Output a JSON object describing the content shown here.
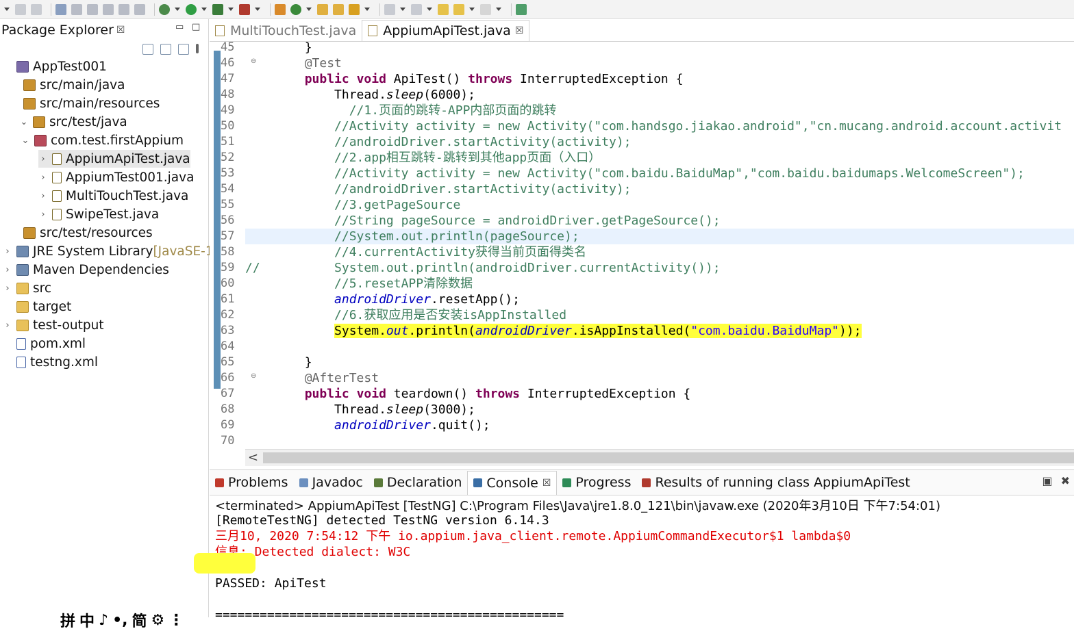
{
  "explorer": {
    "title": "Package Explorer",
    "close": "☒",
    "items": [
      {
        "label": "AppTest001",
        "decor": "",
        "twisty": "",
        "icon": "project-icon",
        "depth": 0
      },
      {
        "label": "src/main/java",
        "decor": "",
        "twisty": "",
        "icon": "source-folder-icon",
        "depth": 1
      },
      {
        "label": "src/main/resources",
        "decor": "",
        "twisty": "",
        "icon": "source-folder-icon",
        "depth": 1
      },
      {
        "label": "src/test/java",
        "decor": "",
        "twisty": "⌄",
        "icon": "source-folder-icon",
        "depth": 1
      },
      {
        "label": "com.test.firstAppium",
        "decor": "",
        "twisty": "⌄",
        "icon": "package-icon",
        "depth": 2
      },
      {
        "label": "AppiumApiTest.java",
        "decor": "",
        "twisty": "›",
        "icon": "java-file-icon",
        "depth": 3,
        "selected": true
      },
      {
        "label": "AppiumTest001.java",
        "decor": "",
        "twisty": "›",
        "icon": "java-file-icon",
        "depth": 3
      },
      {
        "label": "MultiTouchTest.java",
        "decor": "",
        "twisty": "›",
        "icon": "java-file-icon",
        "depth": 3
      },
      {
        "label": "SwipeTest.java",
        "decor": "",
        "twisty": "›",
        "icon": "java-file-icon",
        "depth": 3
      },
      {
        "label": "src/test/resources",
        "decor": "",
        "twisty": "",
        "icon": "source-folder-icon",
        "depth": 1
      },
      {
        "label": "JRE System Library ",
        "decor": "[JavaSE-1.",
        "twisty": "›",
        "icon": "library-icon",
        "depth": 0
      },
      {
        "label": "Maven Dependencies",
        "decor": "",
        "twisty": "›",
        "icon": "library-icon",
        "depth": 0
      },
      {
        "label": "src",
        "decor": "",
        "twisty": "›",
        "icon": "folder-icon",
        "depth": 0
      },
      {
        "label": "target",
        "decor": "",
        "twisty": "",
        "icon": "folder-icon",
        "depth": 0
      },
      {
        "label": "test-output",
        "decor": "",
        "twisty": "›",
        "icon": "folder-icon",
        "depth": 0
      },
      {
        "label": "pom.xml",
        "decor": "",
        "twisty": "",
        "icon": "xml-file-icon",
        "depth": 0
      },
      {
        "label": "testng.xml",
        "decor": "",
        "twisty": "",
        "icon": "xml-file-icon",
        "depth": 0
      }
    ]
  },
  "ime": {
    "items": [
      "拼",
      "中",
      "♪",
      "•,",
      "简",
      "⚙",
      "⋮"
    ]
  },
  "editor": {
    "tabs": [
      {
        "label": "MultiTouchTest.java",
        "active": false
      },
      {
        "label": "AppiumApiTest.java",
        "active": true
      }
    ],
    "close": "☒",
    "lines": [
      {
        "n": "45",
        "fold": "",
        "segs": [
          {
            "t": "        }"
          }
        ]
      },
      {
        "n": "46",
        "fold": "⊖",
        "segs": [
          {
            "t": "        "
          },
          {
            "t": "@Test",
            "c": "an"
          }
        ]
      },
      {
        "n": "47",
        "fold": "",
        "segs": [
          {
            "t": "        "
          },
          {
            "t": "public",
            "c": "kw"
          },
          {
            "t": " "
          },
          {
            "t": "void",
            "c": "kw"
          },
          {
            "t": " ApiTest() "
          },
          {
            "t": "throws",
            "c": "kw"
          },
          {
            "t": " InterruptedException {"
          }
        ]
      },
      {
        "n": "48",
        "fold": "",
        "segs": [
          {
            "t": "            Thread."
          },
          {
            "t": "sleep",
            "c": "it"
          },
          {
            "t": "(6000);"
          }
        ]
      },
      {
        "n": "49",
        "fold": "",
        "segs": [
          {
            "t": "              "
          },
          {
            "t": "//1.页面的跳转-APP内部页面的跳转",
            "c": "cm"
          }
        ]
      },
      {
        "n": "50",
        "fold": "",
        "segs": [
          {
            "t": "            "
          },
          {
            "t": "//Activity activity = new Activity(\"com.handsgo.jiakao.android\",\"cn.mucang.android.account.activit",
            "c": "cm"
          }
        ]
      },
      {
        "n": "51",
        "fold": "",
        "segs": [
          {
            "t": "            "
          },
          {
            "t": "//androidDriver.startActivity(activity);",
            "c": "cm"
          }
        ]
      },
      {
        "n": "52",
        "fold": "",
        "segs": [
          {
            "t": "            "
          },
          {
            "t": "//2.app相互跳转-跳转到其他app页面（入口）",
            "c": "cm"
          }
        ]
      },
      {
        "n": "53",
        "fold": "",
        "segs": [
          {
            "t": "            "
          },
          {
            "t": "//Activity activity = new Activity(\"com.baidu.BaiduMap\",\"com.baidu.baidumaps.WelcomeScreen\");",
            "c": "cm"
          }
        ]
      },
      {
        "n": "54",
        "fold": "",
        "segs": [
          {
            "t": "            "
          },
          {
            "t": "//androidDriver.startActivity(activity);",
            "c": "cm"
          }
        ]
      },
      {
        "n": "55",
        "fold": "",
        "segs": [
          {
            "t": "            "
          },
          {
            "t": "//3.getPageSource",
            "c": "cm"
          }
        ]
      },
      {
        "n": "56",
        "fold": "",
        "segs": [
          {
            "t": "            "
          },
          {
            "t": "//String pageSource = androidDriver.getPageSource();",
            "c": "cm"
          }
        ]
      },
      {
        "n": "57",
        "fold": "",
        "cur": true,
        "segs": [
          {
            "t": "            "
          },
          {
            "t": "//System.out.println(pageSource);",
            "c": "cm"
          }
        ]
      },
      {
        "n": "58",
        "fold": "",
        "segs": [
          {
            "t": "            "
          },
          {
            "t": "//4.currentActivity获得当前页面得类名",
            "c": "cm"
          }
        ]
      },
      {
        "n": "59",
        "fold": "",
        "segs": [
          {
            "t": "//",
            "c": "cm"
          },
          {
            "t": "          System.out.println(androidDriver.currentActivity());",
            "c": "cm"
          }
        ]
      },
      {
        "n": "60",
        "fold": "",
        "segs": [
          {
            "t": "            "
          },
          {
            "t": "//5.resetAPP清除数据",
            "c": "cm"
          }
        ]
      },
      {
        "n": "61",
        "fold": "",
        "segs": [
          {
            "t": "            "
          },
          {
            "t": "androidDriver",
            "c": "fi"
          },
          {
            "t": ".resetApp();"
          }
        ]
      },
      {
        "n": "62",
        "fold": "",
        "segs": [
          {
            "t": "            "
          },
          {
            "t": "//6.获取应用是否安装isAppInstalled",
            "c": "cm"
          }
        ]
      },
      {
        "n": "63",
        "fold": "",
        "segs": [
          {
            "t": "            "
          },
          {
            "t": "System.",
            "c": "hl"
          },
          {
            "t": "out",
            "c": "hl fi"
          },
          {
            "t": ".println(",
            "c": "hl"
          },
          {
            "t": "androidDriver",
            "c": "hl fi"
          },
          {
            "t": ".isAppInstalled(",
            "c": "hl"
          },
          {
            "t": "\"com.baidu.BaiduMap\"",
            "c": "hl st"
          },
          {
            "t": "));",
            "c": "hl"
          }
        ]
      },
      {
        "n": "64",
        "fold": "",
        "segs": [
          {
            "t": ""
          }
        ]
      },
      {
        "n": "65",
        "fold": "",
        "segs": [
          {
            "t": "        }"
          }
        ]
      },
      {
        "n": "66",
        "fold": "⊖",
        "segs": [
          {
            "t": "        "
          },
          {
            "t": "@AfterTest",
            "c": "an"
          }
        ]
      },
      {
        "n": "67",
        "fold": "",
        "segs": [
          {
            "t": "        "
          },
          {
            "t": "public",
            "c": "kw"
          },
          {
            "t": " "
          },
          {
            "t": "void",
            "c": "kw"
          },
          {
            "t": " teardown() "
          },
          {
            "t": "throws",
            "c": "kw"
          },
          {
            "t": " InterruptedException {"
          }
        ]
      },
      {
        "n": "68",
        "fold": "",
        "segs": [
          {
            "t": "            Thread."
          },
          {
            "t": "sleep",
            "c": "it"
          },
          {
            "t": "(3000);"
          }
        ]
      },
      {
        "n": "69",
        "fold": "",
        "segs": [
          {
            "t": "            "
          },
          {
            "t": "androidDriver",
            "c": "fi"
          },
          {
            "t": ".quit();"
          }
        ]
      },
      {
        "n": "70",
        "fold": "",
        "segs": [
          {
            "t": ""
          }
        ]
      }
    ],
    "scroll_left": "<"
  },
  "console": {
    "tabs": [
      {
        "label": "Problems",
        "icon": "problems-icon",
        "color": "#c0392b"
      },
      {
        "label": "Javadoc",
        "icon": "javadoc-icon",
        "color": "#6b8fbf"
      },
      {
        "label": "Declaration",
        "icon": "declaration-icon",
        "color": "#5a7a3a"
      },
      {
        "label": "Console",
        "icon": "console-icon",
        "color": "#3a6ea5",
        "active": true
      },
      {
        "label": "Progress",
        "icon": "progress-icon",
        "color": "#2e8b57"
      },
      {
        "label": "Results of running class AppiumApiTest",
        "icon": "testng-icon",
        "color": "#b03a2e"
      }
    ],
    "close": "☒",
    "controls": [
      "▣",
      "✖"
    ],
    "terminated": "<terminated> AppiumApiTest [TestNG] C:\\Program Files\\Java\\jre1.8.0_121\\bin\\javaw.exe (2020年3月10日 下午7:54:01)",
    "output": [
      {
        "text": "[RemoteTestNG] detected TestNG version 6.14.3",
        "err": false
      },
      {
        "text": "三月10, 2020 7:54:12 下午 io.appium.java_client.remote.AppiumCommandExecutor$1 lambda$0",
        "err": true
      },
      {
        "text": "信息: Detected dialect: W3C",
        "err": true
      },
      {
        "text": "true",
        "err": false
      },
      {
        "text": "PASSED: ApiTest",
        "err": false
      },
      {
        "text": "",
        "err": false
      },
      {
        "text": "===============================================",
        "err": false
      }
    ]
  },
  "colors": {
    "keyword": "#7f0055",
    "comment": "#3f7f5f",
    "string": "#2a00ff",
    "field": "#0000c0",
    "highlight": "#ffff3c",
    "error": "#e00000"
  }
}
